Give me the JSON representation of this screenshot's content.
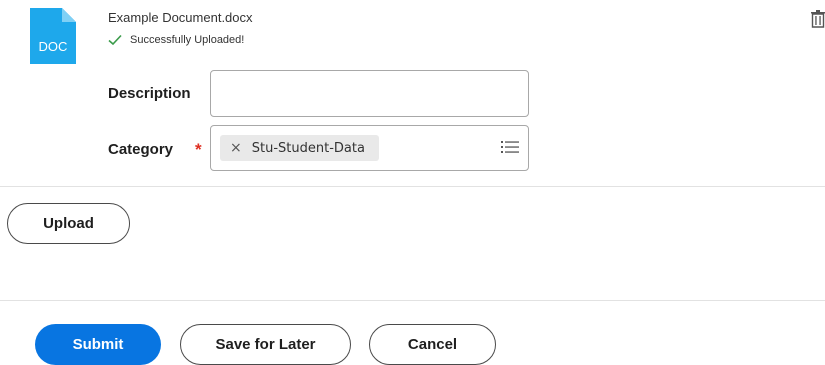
{
  "attachment": {
    "icon_label": "DOC",
    "file_name": "Example Document.docx",
    "status": "Successfully Uploaded!"
  },
  "form": {
    "description_label": "Description",
    "description_value": "",
    "category_label": "Category",
    "category_required_marker": "*",
    "category_selected": "Stu-Student-Data",
    "remove_symbol": "×"
  },
  "buttons": {
    "upload": "Upload",
    "submit": "Submit",
    "save_for_later": "Save for Later",
    "cancel": "Cancel"
  },
  "colors": {
    "doc_icon": "#1ea8eb",
    "primary_button": "#0875e1",
    "success_check": "#3a9b4a",
    "required": "#de2e21"
  }
}
